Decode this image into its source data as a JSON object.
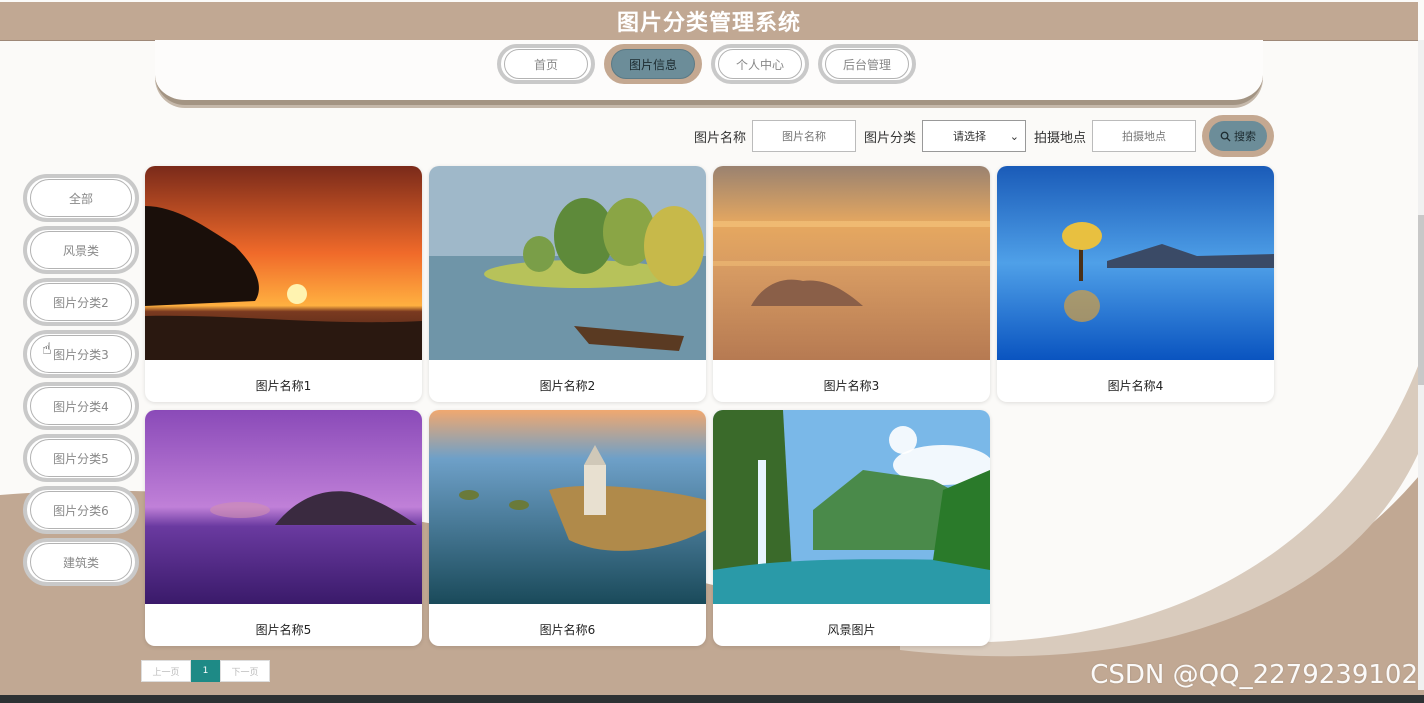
{
  "header": {
    "title": "图片分类管理系统"
  },
  "nav": [
    {
      "label": "首页",
      "active": false
    },
    {
      "label": "图片信息",
      "active": true
    },
    {
      "label": "个人中心",
      "active": false
    },
    {
      "label": "后台管理",
      "active": false
    }
  ],
  "search": {
    "name_label": "图片名称",
    "name_placeholder": "图片名称",
    "category_label": "图片分类",
    "category_value": "请选择",
    "location_label": "拍摄地点",
    "location_placeholder": "拍摄地点",
    "button_label": "搜索"
  },
  "categories": [
    "全部",
    "风景类",
    "图片分类2",
    "图片分类3",
    "图片分类4",
    "图片分类5",
    "图片分类6",
    "建筑类"
  ],
  "cards": [
    {
      "caption": "图片名称1",
      "scene": "sunset-beach"
    },
    {
      "caption": "图片名称2",
      "scene": "painted-lake-trees"
    },
    {
      "caption": "图片名称3",
      "scene": "orange-sky-clouds"
    },
    {
      "caption": "图片名称4",
      "scene": "lone-tree-lake"
    },
    {
      "caption": "图片名称5",
      "scene": "purple-sea-island"
    },
    {
      "caption": "图片名称6",
      "scene": "island-castle-aerial"
    },
    {
      "caption": "风景图片",
      "scene": "waterfall-valley"
    }
  ],
  "pagination": {
    "prev": "上一页",
    "current": "1",
    "next": "下一页"
  },
  "watermark": "CSDN @QQ_2279239102",
  "colors": {
    "header": "#c1a893",
    "accent": "#6c8d99",
    "page_active": "#1e8a86"
  }
}
